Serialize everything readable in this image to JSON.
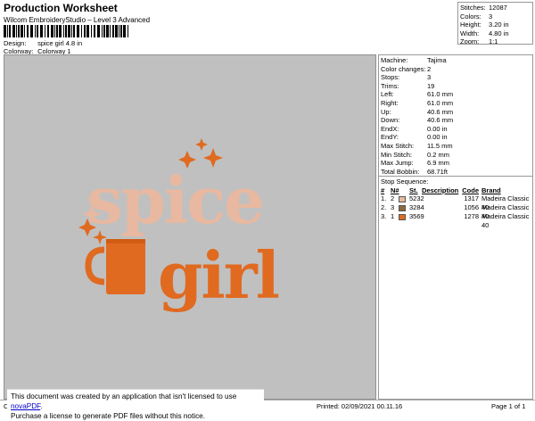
{
  "header": {
    "title": "Production Worksheet",
    "subtitle": "Wilcom EmbroideryStudio – Level 3 Advanced"
  },
  "meta": {
    "design_label": "Design:",
    "design_value": "spice girl 4.8 in",
    "colorway_label": "Colorway:",
    "colorway_value": "Colorway 1"
  },
  "summary": [
    {
      "label": "Stitches:",
      "value": "12087"
    },
    {
      "label": "Colors:",
      "value": "3"
    },
    {
      "label": "Height:",
      "value": "3.20 in"
    },
    {
      "label": "Width:",
      "value": "4.80 in"
    },
    {
      "label": "Zoom:",
      "value": "1:1"
    }
  ],
  "machine": [
    {
      "label": "Machine:",
      "value": "Tajima"
    },
    {
      "label": "Color changes:",
      "value": "2"
    },
    {
      "label": "Stops:",
      "value": "3"
    },
    {
      "label": "Trims:",
      "value": "19"
    },
    {
      "label": "Left:",
      "value": "61.0 mm"
    },
    {
      "label": "Right:",
      "value": "61.0 mm"
    },
    {
      "label": "Up:",
      "value": "40.6 mm"
    },
    {
      "label": "Down:",
      "value": "40.6 mm"
    },
    {
      "label": "EndX:",
      "value": "0.00 in"
    },
    {
      "label": "EndY:",
      "value": "0.00 in"
    },
    {
      "label": "Max Stitch:",
      "value": "11.5 mm"
    },
    {
      "label": "Min Stitch:",
      "value": "0.2 mm"
    },
    {
      "label": "Max Jump:",
      "value": "6.9 mm"
    },
    {
      "label": "Total Bobbin:",
      "value": "68.71ft"
    }
  ],
  "stops": {
    "title": "Stop Sequence:",
    "headers": {
      "num": "#",
      "n": "N#",
      "st": "St.",
      "desc": "Description",
      "code": "Code",
      "brand": "Brand"
    },
    "rows": [
      {
        "num": "1.",
        "n": "2",
        "color": "#e8b8a0",
        "st": "5232",
        "desc": "",
        "code": "1317",
        "brand": "Madeira Classic 40"
      },
      {
        "num": "2.",
        "n": "3",
        "color": "#8a6a40",
        "st": "3284",
        "desc": "",
        "code": "1056",
        "brand": "Madeira Classic 40"
      },
      {
        "num": "3.",
        "n": "1",
        "color": "#e06a20",
        "st": "3569",
        "desc": "",
        "code": "1278",
        "brand": "Madeira Classic 40"
      }
    ]
  },
  "artwork": {
    "word1": "spice",
    "word2": "girl",
    "colors": {
      "peach": "#e8b8a0",
      "brown": "#8a6a40",
      "orange": "#e06a20",
      "background": "#c0c0c0"
    }
  },
  "notice": {
    "line1": "This document was created by an application that isn't licensed to use",
    "link": "novaPDF",
    "line2": "Purchase a license to generate PDF files without this notice."
  },
  "footer": {
    "left": "Cr",
    "printed": "Printed: 02/09/2021 00.11.16",
    "page": "Page 1 of 1"
  }
}
